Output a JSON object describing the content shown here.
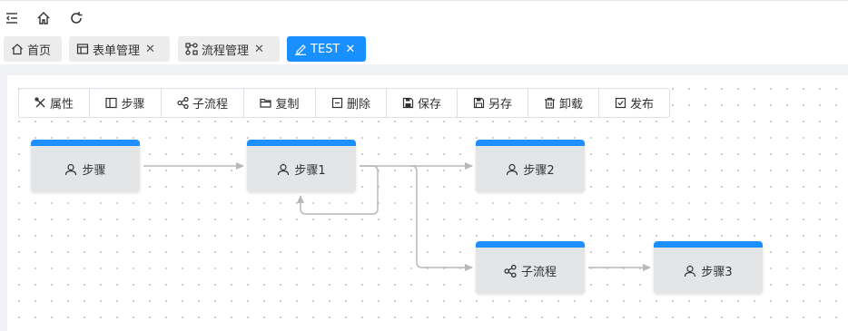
{
  "header": {
    "icons": [
      "menu-fold-icon",
      "home-icon",
      "refresh-icon"
    ]
  },
  "tabs": [
    {
      "label": "首页",
      "icon": "home-icon",
      "closable": false,
      "active": false
    },
    {
      "label": "表单管理",
      "icon": "form-icon",
      "closable": true,
      "active": false
    },
    {
      "label": "流程管理",
      "icon": "flow-icon",
      "closable": true,
      "active": false
    },
    {
      "label": "TEST",
      "icon": "edit-icon",
      "closable": true,
      "active": true
    }
  ],
  "toolbar": [
    {
      "label": "属性",
      "icon": "tools-icon"
    },
    {
      "label": "步骤",
      "icon": "panel-icon"
    },
    {
      "label": "子流程",
      "icon": "share-icon"
    },
    {
      "label": "复制",
      "icon": "folder-icon"
    },
    {
      "label": "删除",
      "icon": "minus-square-icon"
    },
    {
      "label": "保存",
      "icon": "save-icon"
    },
    {
      "label": "另存",
      "icon": "save-as-icon"
    },
    {
      "label": "卸载",
      "icon": "trash-icon"
    },
    {
      "label": "发布",
      "icon": "check-square-icon"
    }
  ],
  "nodes": [
    {
      "label": "步骤",
      "icon": "user-icon"
    },
    {
      "label": "步骤1",
      "icon": "user-icon"
    },
    {
      "label": "步骤2",
      "icon": "user-icon"
    },
    {
      "label": "子流程",
      "icon": "share-icon"
    },
    {
      "label": "步骤3",
      "icon": "user-icon"
    }
  ],
  "colors": {
    "accent": "#1890ff",
    "node_header": "#1e8fff",
    "node_body": "#e4e5e7",
    "edge": "#b8b8b8",
    "tab_bg": "#ececec"
  }
}
